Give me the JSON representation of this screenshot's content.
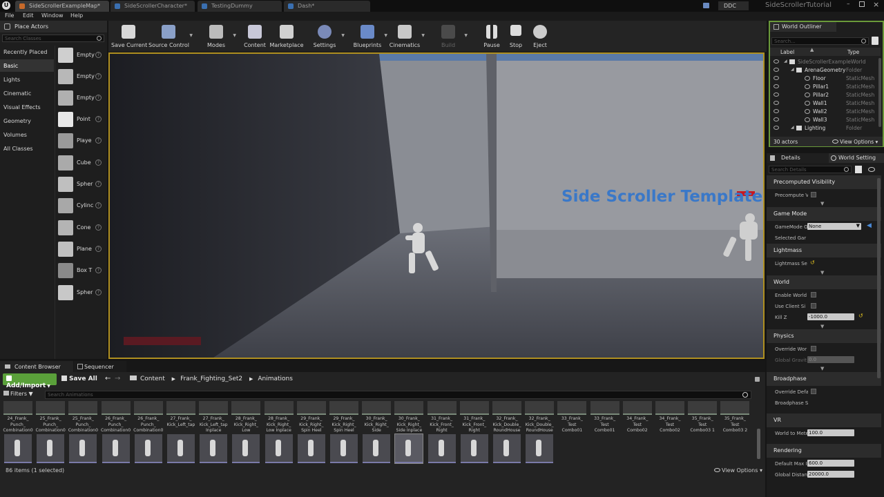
{
  "window": {
    "tabs": [
      "SideScrollerExampleMap*",
      "SideScrollerCharacter*",
      "TestingDummy",
      "Dash*"
    ],
    "project": "SideScrollerTutorial",
    "ddc": "DDC"
  },
  "menu": [
    "File",
    "Edit",
    "Window",
    "Help"
  ],
  "place_actors": {
    "title": "Place Actors",
    "search_placeholder": "Search Classes",
    "categories": [
      "Recently Placed",
      "Basic",
      "Lights",
      "Cinematic",
      "Visual Effects",
      "Geometry",
      "Volumes",
      "All Classes"
    ],
    "selected_category": "Basic",
    "items": [
      "Empty",
      "Empty",
      "Empty",
      "Point",
      "Playe",
      "Cube",
      "Spher",
      "Cylinc",
      "Cone",
      "Plane",
      "Box T",
      "Spher"
    ],
    "help": "?"
  },
  "toolbar": [
    "Save Current",
    "Source Control",
    "Modes",
    "Content",
    "Marketplace",
    "Settings",
    "Blueprints",
    "Cinematics",
    "Build",
    "Pause",
    "Stop",
    "Eject"
  ],
  "viewport": {
    "overlay_text": "Side Scroller Template"
  },
  "outliner": {
    "title": "World Outliner",
    "search_placeholder": "Search...",
    "col_label": "Label",
    "col_type": "Type",
    "rows": [
      {
        "name": "SideScrollerExampleWorld",
        "type": ""
      },
      {
        "name": "ArenaGeometry",
        "type": "Folder"
      },
      {
        "name": "Floor",
        "type": "StaticMesh"
      },
      {
        "name": "Pillar1",
        "type": "StaticMesh"
      },
      {
        "name": "Pillar2",
        "type": "StaticMesh"
      },
      {
        "name": "Wall1",
        "type": "StaticMesh"
      },
      {
        "name": "Wall2",
        "type": "StaticMesh"
      },
      {
        "name": "Wall3",
        "type": "StaticMesh"
      },
      {
        "name": "Lighting",
        "type": "Folder"
      }
    ],
    "count": "30 actors",
    "view_options": "View Options"
  },
  "details": {
    "tab1": "Details",
    "tab2": "World Setting",
    "search_placeholder": "Search Details",
    "sections": [
      "Precomputed Visibility",
      "Game Mode",
      "Lightmass",
      "World",
      "Physics",
      "Broadphase",
      "VR",
      "Rendering"
    ],
    "props": {
      "precompute": "Precompute V",
      "gamemode": "GameMode O",
      "gamemode_value": "None",
      "selected": "Selected Gar",
      "lightmass": "Lightmass Se",
      "enable_world": "Enable World",
      "use_client": "Use Client Si",
      "killz": "Kill Z",
      "killz_value": "-1000.0",
      "override_world": "Override Wor",
      "global_gravity": "Global Gravit",
      "global_gravity_value": "0.0",
      "override_defaults": "Override Defa",
      "broadphase_settings": "Broadphase S",
      "world_to_meters": "World to Mete",
      "world_to_meters_value": "100.0",
      "default_max": "Default Max I",
      "default_max_value": "600.0",
      "global_distance": "Global Distan",
      "global_distance_value": "20000.0"
    }
  },
  "content_browser": {
    "tab1": "Content Browser",
    "tab2": "Sequencer",
    "add_import": "Add/Import",
    "save_all": "Save All",
    "path": [
      "Content",
      "Frank_Fighting_Set2",
      "Animations"
    ],
    "filters": "Filters",
    "search_placeholder": "Search Animations",
    "assets": [
      [
        "24_Frank_",
        "Punch_",
        "Combination0"
      ],
      [
        "25_Frank_",
        "Punch_",
        "Combination0"
      ],
      [
        "25_Frank_",
        "Punch_",
        "Combination0"
      ],
      [
        "26_Frank_",
        "Punch_",
        "Combination0"
      ],
      [
        "26_Frank_",
        "Punch_",
        "Combination0"
      ],
      [
        "27_Frank_",
        "Kick_Left_tap",
        ""
      ],
      [
        "27_Frank_",
        "Kick_Left_tap",
        "Inplace"
      ],
      [
        "28_Frank_",
        "Kick_Right_",
        "Low"
      ],
      [
        "28_Frank_",
        "Kick_Right_",
        "Low Inplace"
      ],
      [
        "29_Frank_",
        "Kick_Right_",
        "Spin Heel"
      ],
      [
        "29_Frank_",
        "Kick_Right_",
        "Spin Heel"
      ],
      [
        "30_Frank_",
        "Kick_Right_",
        "Side"
      ],
      [
        "30_Frank_",
        "Kick_Right_",
        "Side Inplace"
      ],
      [
        "31_Frank_",
        "Kick_Front_",
        "Right"
      ],
      [
        "31_Frank_",
        "Kick_Front_",
        "Right"
      ],
      [
        "32_Frank_",
        "Kick_Double_",
        "RoundHouse"
      ],
      [
        "32_Frank_",
        "Kick_Double_",
        "RoundHouse"
      ],
      [
        "33_Frank_",
        "Test",
        "Combo01"
      ],
      [
        "33_Frank_",
        "Test",
        "Combo01"
      ],
      [
        "34_Frank_",
        "Test",
        "Combo02"
      ],
      [
        "34_Frank_",
        "Test",
        "Combo02"
      ],
      [
        "35_Frank_",
        "Test",
        "Combo03 1"
      ],
      [
        "35_Frank_",
        "Test",
        "Combo03 2"
      ]
    ],
    "status": "86 items (1 selected)",
    "view_options": "View Options"
  }
}
